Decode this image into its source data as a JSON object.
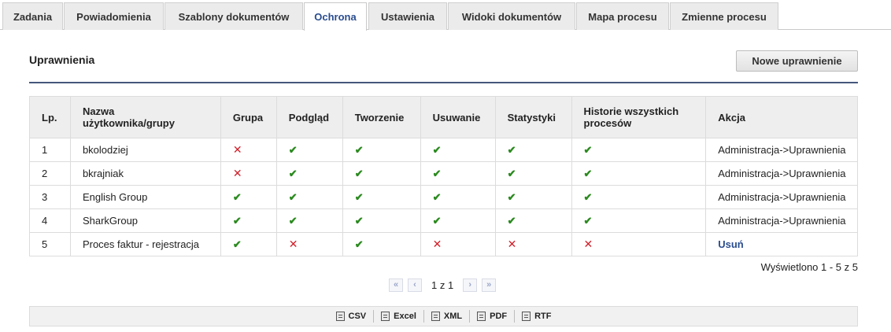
{
  "tabs": [
    {
      "label": "Zadania",
      "active": false
    },
    {
      "label": "Powiadomienia",
      "active": false
    },
    {
      "label": "Szablony dokumentów",
      "active": false
    },
    {
      "label": "Ochrona",
      "active": true
    },
    {
      "label": "Ustawienia",
      "active": false
    },
    {
      "label": "Widoki dokumentów",
      "active": false
    },
    {
      "label": "Mapa procesu",
      "active": false
    },
    {
      "label": "Zmienne procesu",
      "active": false
    }
  ],
  "section": {
    "title": "Uprawnienia",
    "new_button": "Nowe uprawnienie"
  },
  "table": {
    "headers": {
      "lp": "Lp.",
      "name": "Nazwa użytkownika/grupy",
      "group": "Grupa",
      "view": "Podgląd",
      "create": "Tworzenie",
      "delete": "Usuwanie",
      "stats": "Statystyki",
      "history": "Historie wszystkich procesów",
      "action": "Akcja"
    },
    "rows": [
      {
        "lp": "1",
        "name": "bkolodziej",
        "group": false,
        "view": true,
        "create": true,
        "delete": true,
        "stats": true,
        "history": true,
        "action": "Administracja->Uprawnienia",
        "action_link": false
      },
      {
        "lp": "2",
        "name": "bkrajniak",
        "group": false,
        "view": true,
        "create": true,
        "delete": true,
        "stats": true,
        "history": true,
        "action": "Administracja->Uprawnienia",
        "action_link": false
      },
      {
        "lp": "3",
        "name": "English Group",
        "group": true,
        "view": true,
        "create": true,
        "delete": true,
        "stats": true,
        "history": true,
        "action": "Administracja->Uprawnienia",
        "action_link": false
      },
      {
        "lp": "4",
        "name": "SharkGroup",
        "group": true,
        "view": true,
        "create": true,
        "delete": true,
        "stats": true,
        "history": true,
        "action": "Administracja->Uprawnienia",
        "action_link": false
      },
      {
        "lp": "5",
        "name": "Proces faktur - rejestracja",
        "group": true,
        "view": false,
        "create": true,
        "delete": false,
        "stats": false,
        "history": false,
        "action": "Usuń",
        "action_link": true
      }
    ]
  },
  "status_text": "Wyświetlono 1 - 5 z 5",
  "pager": {
    "first_icon": "double-chevron-left-icon",
    "prev_icon": "chevron-left-icon",
    "page_text": "1 z 1",
    "next_icon": "chevron-right-icon",
    "last_icon": "double-chevron-right-icon"
  },
  "export": [
    "CSV",
    "Excel",
    "XML",
    "PDF",
    "RTF"
  ],
  "colors": {
    "check": "#2b8a1f",
    "cross": "#d2202a",
    "accent": "#2a4d8f"
  }
}
